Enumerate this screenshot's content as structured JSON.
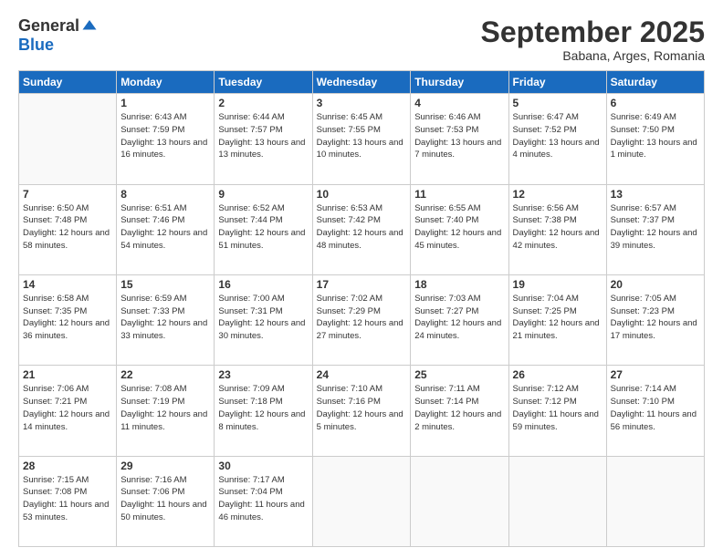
{
  "logo": {
    "general": "General",
    "blue": "Blue"
  },
  "header": {
    "month": "September 2025",
    "location": "Babana, Arges, Romania"
  },
  "days": [
    "Sunday",
    "Monday",
    "Tuesday",
    "Wednesday",
    "Thursday",
    "Friday",
    "Saturday"
  ],
  "weeks": [
    [
      {
        "day": "",
        "sunrise": "",
        "sunset": "",
        "daylight": ""
      },
      {
        "day": "1",
        "sunrise": "Sunrise: 6:43 AM",
        "sunset": "Sunset: 7:59 PM",
        "daylight": "Daylight: 13 hours and 16 minutes."
      },
      {
        "day": "2",
        "sunrise": "Sunrise: 6:44 AM",
        "sunset": "Sunset: 7:57 PM",
        "daylight": "Daylight: 13 hours and 13 minutes."
      },
      {
        "day": "3",
        "sunrise": "Sunrise: 6:45 AM",
        "sunset": "Sunset: 7:55 PM",
        "daylight": "Daylight: 13 hours and 10 minutes."
      },
      {
        "day": "4",
        "sunrise": "Sunrise: 6:46 AM",
        "sunset": "Sunset: 7:53 PM",
        "daylight": "Daylight: 13 hours and 7 minutes."
      },
      {
        "day": "5",
        "sunrise": "Sunrise: 6:47 AM",
        "sunset": "Sunset: 7:52 PM",
        "daylight": "Daylight: 13 hours and 4 minutes."
      },
      {
        "day": "6",
        "sunrise": "Sunrise: 6:49 AM",
        "sunset": "Sunset: 7:50 PM",
        "daylight": "Daylight: 13 hours and 1 minute."
      }
    ],
    [
      {
        "day": "7",
        "sunrise": "Sunrise: 6:50 AM",
        "sunset": "Sunset: 7:48 PM",
        "daylight": "Daylight: 12 hours and 58 minutes."
      },
      {
        "day": "8",
        "sunrise": "Sunrise: 6:51 AM",
        "sunset": "Sunset: 7:46 PM",
        "daylight": "Daylight: 12 hours and 54 minutes."
      },
      {
        "day": "9",
        "sunrise": "Sunrise: 6:52 AM",
        "sunset": "Sunset: 7:44 PM",
        "daylight": "Daylight: 12 hours and 51 minutes."
      },
      {
        "day": "10",
        "sunrise": "Sunrise: 6:53 AM",
        "sunset": "Sunset: 7:42 PM",
        "daylight": "Daylight: 12 hours and 48 minutes."
      },
      {
        "day": "11",
        "sunrise": "Sunrise: 6:55 AM",
        "sunset": "Sunset: 7:40 PM",
        "daylight": "Daylight: 12 hours and 45 minutes."
      },
      {
        "day": "12",
        "sunrise": "Sunrise: 6:56 AM",
        "sunset": "Sunset: 7:38 PM",
        "daylight": "Daylight: 12 hours and 42 minutes."
      },
      {
        "day": "13",
        "sunrise": "Sunrise: 6:57 AM",
        "sunset": "Sunset: 7:37 PM",
        "daylight": "Daylight: 12 hours and 39 minutes."
      }
    ],
    [
      {
        "day": "14",
        "sunrise": "Sunrise: 6:58 AM",
        "sunset": "Sunset: 7:35 PM",
        "daylight": "Daylight: 12 hours and 36 minutes."
      },
      {
        "day": "15",
        "sunrise": "Sunrise: 6:59 AM",
        "sunset": "Sunset: 7:33 PM",
        "daylight": "Daylight: 12 hours and 33 minutes."
      },
      {
        "day": "16",
        "sunrise": "Sunrise: 7:00 AM",
        "sunset": "Sunset: 7:31 PM",
        "daylight": "Daylight: 12 hours and 30 minutes."
      },
      {
        "day": "17",
        "sunrise": "Sunrise: 7:02 AM",
        "sunset": "Sunset: 7:29 PM",
        "daylight": "Daylight: 12 hours and 27 minutes."
      },
      {
        "day": "18",
        "sunrise": "Sunrise: 7:03 AM",
        "sunset": "Sunset: 7:27 PM",
        "daylight": "Daylight: 12 hours and 24 minutes."
      },
      {
        "day": "19",
        "sunrise": "Sunrise: 7:04 AM",
        "sunset": "Sunset: 7:25 PM",
        "daylight": "Daylight: 12 hours and 21 minutes."
      },
      {
        "day": "20",
        "sunrise": "Sunrise: 7:05 AM",
        "sunset": "Sunset: 7:23 PM",
        "daylight": "Daylight: 12 hours and 17 minutes."
      }
    ],
    [
      {
        "day": "21",
        "sunrise": "Sunrise: 7:06 AM",
        "sunset": "Sunset: 7:21 PM",
        "daylight": "Daylight: 12 hours and 14 minutes."
      },
      {
        "day": "22",
        "sunrise": "Sunrise: 7:08 AM",
        "sunset": "Sunset: 7:19 PM",
        "daylight": "Daylight: 12 hours and 11 minutes."
      },
      {
        "day": "23",
        "sunrise": "Sunrise: 7:09 AM",
        "sunset": "Sunset: 7:18 PM",
        "daylight": "Daylight: 12 hours and 8 minutes."
      },
      {
        "day": "24",
        "sunrise": "Sunrise: 7:10 AM",
        "sunset": "Sunset: 7:16 PM",
        "daylight": "Daylight: 12 hours and 5 minutes."
      },
      {
        "day": "25",
        "sunrise": "Sunrise: 7:11 AM",
        "sunset": "Sunset: 7:14 PM",
        "daylight": "Daylight: 12 hours and 2 minutes."
      },
      {
        "day": "26",
        "sunrise": "Sunrise: 7:12 AM",
        "sunset": "Sunset: 7:12 PM",
        "daylight": "Daylight: 11 hours and 59 minutes."
      },
      {
        "day": "27",
        "sunrise": "Sunrise: 7:14 AM",
        "sunset": "Sunset: 7:10 PM",
        "daylight": "Daylight: 11 hours and 56 minutes."
      }
    ],
    [
      {
        "day": "28",
        "sunrise": "Sunrise: 7:15 AM",
        "sunset": "Sunset: 7:08 PM",
        "daylight": "Daylight: 11 hours and 53 minutes."
      },
      {
        "day": "29",
        "sunrise": "Sunrise: 7:16 AM",
        "sunset": "Sunset: 7:06 PM",
        "daylight": "Daylight: 11 hours and 50 minutes."
      },
      {
        "day": "30",
        "sunrise": "Sunrise: 7:17 AM",
        "sunset": "Sunset: 7:04 PM",
        "daylight": "Daylight: 11 hours and 46 minutes."
      },
      {
        "day": "",
        "sunrise": "",
        "sunset": "",
        "daylight": ""
      },
      {
        "day": "",
        "sunrise": "",
        "sunset": "",
        "daylight": ""
      },
      {
        "day": "",
        "sunrise": "",
        "sunset": "",
        "daylight": ""
      },
      {
        "day": "",
        "sunrise": "",
        "sunset": "",
        "daylight": ""
      }
    ]
  ]
}
